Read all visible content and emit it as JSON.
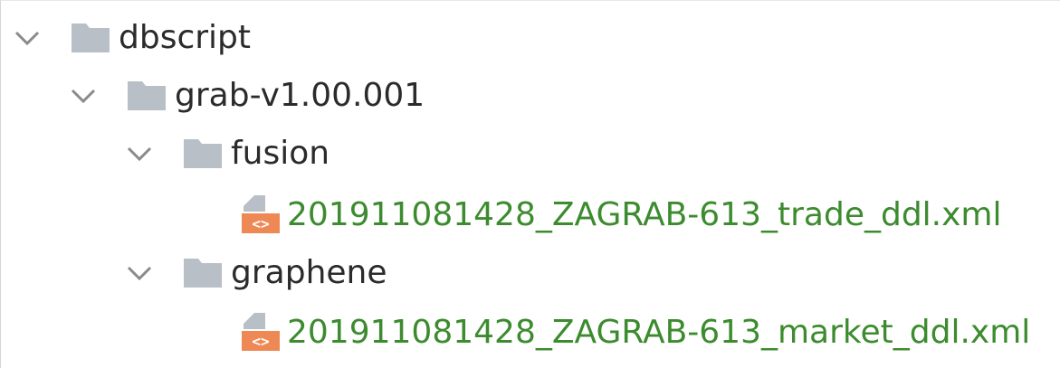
{
  "tree": {
    "nodes": [
      {
        "label": "dbscript",
        "type": "folder",
        "expanded": true,
        "icon": "folder-icon"
      },
      {
        "label": "grab-v1.00.001",
        "type": "folder",
        "expanded": true,
        "icon": "folder-icon"
      },
      {
        "label": "fusion",
        "type": "folder",
        "expanded": true,
        "icon": "folder-icon"
      },
      {
        "label": "201911081428_ZAGRAB-613_trade_ddl.xml",
        "type": "file",
        "icon": "xml-file-icon"
      },
      {
        "label": "graphene",
        "type": "folder",
        "expanded": true,
        "icon": "folder-icon"
      },
      {
        "label": "201911081428_ZAGRAB-613_market_ddl.xml",
        "type": "file",
        "icon": "xml-file-icon"
      }
    ]
  },
  "colors": {
    "folder_icon": "#b9bfc6",
    "file_label": "#3c8b2e",
    "folder_label": "#2b2b2b",
    "xml_badge": "#ee8855",
    "chevron": "#8a8a8a"
  }
}
